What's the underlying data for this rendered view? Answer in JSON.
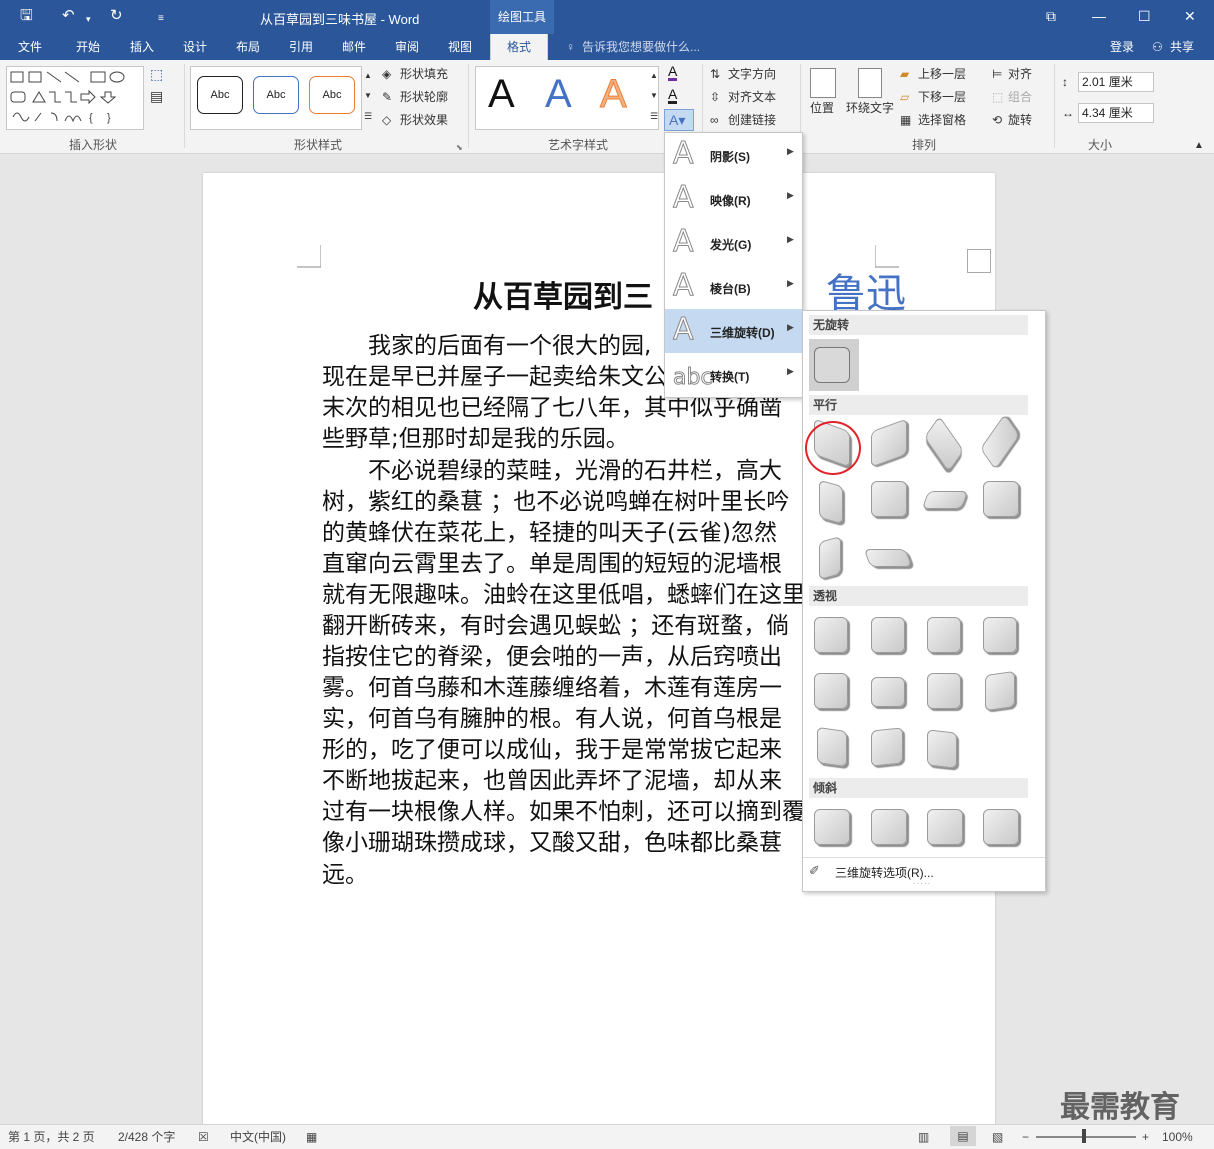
{
  "window": {
    "title": "从百草园到三味书屋 - Word",
    "context_tab": "绘图工具"
  },
  "tabs": [
    "文件",
    "开始",
    "插入",
    "设计",
    "布局",
    "引用",
    "邮件",
    "审阅",
    "视图",
    "格式"
  ],
  "tell_me": "告诉我您想要做什么...",
  "account": {
    "login": "登录",
    "share": "共享"
  },
  "ribbon": {
    "groups": {
      "insert_shapes": "插入形状",
      "shape_styles": "形状样式",
      "wordart_styles": "艺术字样式",
      "arrange": "排列",
      "size": "大小"
    },
    "shape_style_samples": [
      "Abc",
      "Abc",
      "Abc"
    ],
    "shape_fill": "形状填充",
    "shape_outline": "形状轮廓",
    "shape_effects": "形状效果",
    "wordart_sample": "A",
    "text_direction": "文字方向",
    "align_text": "对齐文本",
    "create_link": "创建链接",
    "position": "位置",
    "wrap_text": "环绕文字",
    "bring_forward": "上移一层",
    "send_backward": "下移一层",
    "selection_pane": "选择窗格",
    "align": "对齐",
    "group": "组合",
    "rotate": "旋转",
    "height": "2.01 厘米",
    "width": "4.34 厘米"
  },
  "document": {
    "title": "从百草园到三",
    "wordart": "鲁迅",
    "lines": [
      "　　我家的后面有一个很大的园,",
      "现在是早已并屋子一起卖给朱文公",
      "末次的相见也已经隔了七八年，其中似乎确凿",
      "些野草;但那时却是我的乐园。",
      "　　不必说碧绿的菜畦，光滑的石井栏，高大",
      "树，紫红的桑葚 ；也不必说鸣蝉在树叶里长吟",
      "的黄蜂伏在菜花上，轻捷的叫天子(云雀)忽然",
      "直窜向云霄里去了。单是周围的短短的泥墙根",
      "就有无限趣味。油蛉在这里低唱，蟋蟀们在这里",
      "翻开断砖来，有时会遇见蜈蚣 ；还有斑蝥，倘",
      "指按住它的脊梁，便会啪的一声，从后窍喷出",
      "雾。何首乌藤和木莲藤缠络着，木莲有莲房一",
      "实，何首乌有臃肿的根。有人说，何首乌根是",
      "形的，吃了便可以成仙，我于是常常拔它起来",
      "不断地拔起来，也曾因此弄坏了泥墙，却从来",
      "过有一块根像人样。如果不怕刺，还可以摘到覆",
      "像小珊瑚珠攒成球，又酸又甜，色味都比桑葚",
      "远。"
    ]
  },
  "text_effects_menu": [
    {
      "label": "阴影(S)",
      "icon": "A"
    },
    {
      "label": "映像(R)",
      "icon": "A"
    },
    {
      "label": "发光(G)",
      "icon": "A"
    },
    {
      "label": "棱台(B)",
      "icon": "A"
    },
    {
      "label": "三维旋转(D)",
      "icon": "A"
    },
    {
      "label": "转换(T)",
      "icon": "abc"
    }
  ],
  "gallery": {
    "no_rotation": "无旋转",
    "parallel": "平行",
    "perspective": "透视",
    "oblique": "倾斜",
    "options": "三维旋转选项(R)..."
  },
  "status": {
    "page": "第 1 页，共 2 页",
    "words": "2/428 个字",
    "language": "中文(中国)",
    "zoom": "100%"
  },
  "watermark": "最需教育",
  "colors": {
    "titlebar": "#2b579a",
    "wordart": "#4472c4",
    "highlight": "#e0242a"
  }
}
